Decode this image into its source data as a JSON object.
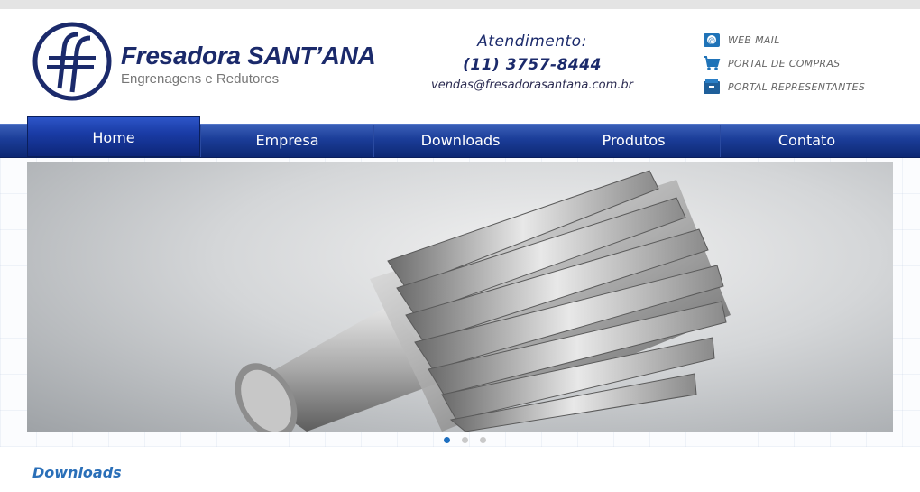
{
  "header": {
    "brand": "Fresadora SANT’ANA",
    "tagline": "Engrenagens e Redutores",
    "contact": {
      "label": "Atendimento:",
      "phone": "(11) 3757-8444",
      "email": "vendas@fresadorasantana.com.br"
    },
    "links": [
      {
        "label": "WEB MAIL",
        "icon": "webmail-icon"
      },
      {
        "label": "PORTAL DE COMPRAS",
        "icon": "cart-icon"
      },
      {
        "label": "PORTAL REPRESENTANTES",
        "icon": "folder-icon"
      }
    ]
  },
  "nav": {
    "items": [
      {
        "label": "Home",
        "active": true
      },
      {
        "label": "Empresa"
      },
      {
        "label": "Downloads"
      },
      {
        "label": "Produtos"
      },
      {
        "label": "Contato"
      }
    ]
  },
  "slider": {
    "slide_count": 3,
    "active_index": 0
  },
  "section": {
    "title": "Downloads"
  },
  "colors": {
    "brand_navy": "#1b2a6b",
    "nav_blue": "#1b3d98",
    "accent_blue": "#2a6fb8"
  }
}
